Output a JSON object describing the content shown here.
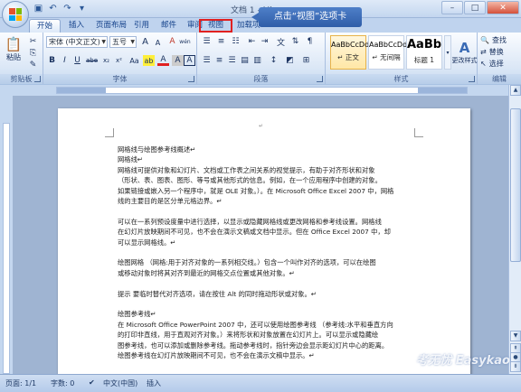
{
  "window": {
    "title": "文档 1 - Mi",
    "minimize": "–",
    "maximize": "□",
    "close": "✕"
  },
  "qat": {
    "save_icon": "save-icon",
    "undo_icon": "undo-icon",
    "redo_icon": "redo-icon"
  },
  "tabs": [
    {
      "label": "开始",
      "active": true
    },
    {
      "label": "插入"
    },
    {
      "label": "页面布局"
    },
    {
      "label": "引用"
    },
    {
      "label": "邮件"
    },
    {
      "label": "审阅"
    },
    {
      "label": "视图",
      "highlighted": true
    },
    {
      "label": "加载项"
    }
  ],
  "callout": {
    "text": "点击“视图”选项卡",
    "color": "#3a69b4"
  },
  "highlight_color": "#e02020",
  "ribbon": {
    "clipboard": {
      "paste_label": "粘贴",
      "group_label": "剪贴板"
    },
    "font": {
      "font_name": "宋体 (中文正文)",
      "font_size": "五号",
      "group_label": "字体",
      "bold": "B",
      "italic": "I",
      "underline": "U",
      "strike": "abe",
      "subscript": "x₂",
      "superscript": "x²",
      "grow": "A",
      "shrink": "A",
      "clear": "A",
      "phonetic": "wén",
      "border_char": "A",
      "highlight": "ab",
      "font_color": "A",
      "shade": "A"
    },
    "paragraph": {
      "group_label": "段落"
    },
    "styles": {
      "group_label": "样式",
      "items": [
        {
          "sample": "AaBbCcDd",
          "name": "↵ 正文",
          "selected": true
        },
        {
          "sample": "AaBbCcDd",
          "name": "↵ 无间隔"
        },
        {
          "sample": "AaBb",
          "name": "标题 1"
        }
      ],
      "change_styles": "更改样式"
    },
    "editing": {
      "group_label": "编辑",
      "find": "查找",
      "replace": "替换",
      "select": "选择"
    }
  },
  "document": {
    "lines": [
      "网格线与绘图参考线概述↵",
      "网格线↵",
      "网格线可提供对象和幻灯片、文档或工作表之间关系的视觉提示，有助于对齐形状和对象",
      "（形状、表、图表、图形、等号或其他形式的信息。例如，在一个应用程序中创建的对象。",
      "如果链接或嵌入另一个程序中，就是 OLE 对象。）。在 Microsoft Office Excel 2007 中，网格",
      "线的主要目的是区分单元格边界。↵",
      "",
      "可以在一系列预设度量中进行选择，以显示或隐藏网格线或更改网格和参考线设置。网格线",
      "在幻灯片放映期间不可见，也不会在演示文稿或文档中显示。但在 Office Excel 2007 中，却",
      "可以显示网格线。↵",
      "",
      "绘图网格 （网格:用于对齐对象的一系列相交线。）包含一个叫作对齐的选项，可以在绘图",
      "或移动对象时将其对齐到最近的网格交点位置或其他对象。↵",
      "",
      " 提示    要临时替代对齐选项，请在按住 Alt 的同时拖动形状或对象。↵",
      "",
      "绘图参考线↵",
      "在 Microsoft Office PowerPoint 2007 中，还可以使用绘图参考线 （参考线:水平和垂直方向",
      "的打印非直线，用于直观对齐对象。）来将形状和对象放置在幻灯片上。可以显示或隐藏绘",
      "图参考线，也可以添加或删除参考线。拖动参考线时，指针旁边会显示距幻灯片中心的距离。",
      "绘图参考线在幻灯片放映期间不可见，也不会在演示文稿中显示。↵"
    ]
  },
  "status": {
    "page": "页面: 1/1",
    "words": "字数: 0",
    "language": "中文(中国)",
    "mode": "插入"
  },
  "watermark": "考无忧 Easykao"
}
